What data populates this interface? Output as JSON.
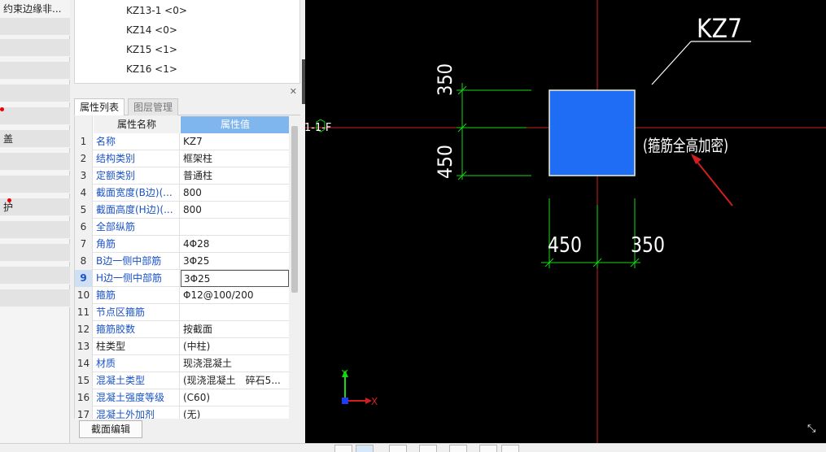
{
  "left_strip": {
    "top_label": "约束边缘非...",
    "items": [
      {
        "label": ""
      },
      {
        "label": ""
      },
      {
        "label": ""
      },
      {
        "label": ""
      },
      {
        "label": ""
      },
      {
        "label": "盖"
      },
      {
        "label": ""
      },
      {
        "label": ""
      },
      {
        "label": "护"
      },
      {
        "label": ""
      },
      {
        "label": ""
      },
      {
        "label": ""
      },
      {
        "label": ""
      }
    ]
  },
  "tree": {
    "items": [
      "KZ13-1 <0>",
      "KZ14 <0>",
      "KZ15 <1>",
      "KZ16 <1>"
    ]
  },
  "tabs": {
    "properties": "属性列表",
    "layers": "图层管理"
  },
  "table": {
    "col_name": "属性名称",
    "col_value": "属性值",
    "rows": [
      {
        "n": "1",
        "name": "名称",
        "value": "KZ7",
        "blue": true
      },
      {
        "n": "2",
        "name": "结构类别",
        "value": "框架柱",
        "blue": true
      },
      {
        "n": "3",
        "name": "定额类别",
        "value": "普通柱",
        "blue": true
      },
      {
        "n": "4",
        "name": "截面宽度(B边)(...",
        "value": "800",
        "blue": true
      },
      {
        "n": "5",
        "name": "截面高度(H边)(...",
        "value": "800",
        "blue": true
      },
      {
        "n": "6",
        "name": "全部纵筋",
        "value": "",
        "blue": true
      },
      {
        "n": "7",
        "name": "角筋",
        "value": "4Φ28",
        "blue": true
      },
      {
        "n": "8",
        "name": "B边一侧中部筋",
        "value": "3Φ25",
        "blue": true
      },
      {
        "n": "9",
        "name": "H边一侧中部筋",
        "value": "3Φ25",
        "blue": true
      },
      {
        "n": "10",
        "name": "箍筋",
        "value": "Φ12@100/200",
        "blue": true
      },
      {
        "n": "11",
        "name": "节点区箍筋",
        "value": "",
        "blue": true
      },
      {
        "n": "12",
        "name": "箍筋胶数",
        "value": "按截面",
        "blue": true
      },
      {
        "n": "13",
        "name": "柱类型",
        "value": "(中柱)",
        "blue": false
      },
      {
        "n": "14",
        "name": "材质",
        "value": "现浇混凝土",
        "blue": true
      },
      {
        "n": "15",
        "name": "混凝土类型",
        "value": "(现浇混凝土　碎石5...",
        "blue": true
      },
      {
        "n": "16",
        "name": "混凝土强度等级",
        "value": "(C60)",
        "blue": true
      },
      {
        "n": "17",
        "name": "混凝土外加剂",
        "value": "(无)",
        "blue": true
      }
    ]
  },
  "section_edit_button": "截面编辑",
  "cad": {
    "axis_label": "1-1-F",
    "column_name": "KZ7",
    "dim_top": "350",
    "dim_bottom": "450",
    "dim_left": "450",
    "dim_right": "350",
    "note": "(箍筋全高加密)",
    "x_axis": "X",
    "y_axis": "Y",
    "colors": {
      "column": "#1f6cf5",
      "grid": "#d11f1f",
      "dim": "#14d814",
      "text": "#ffffff",
      "arrow": "#d11f1f"
    }
  }
}
